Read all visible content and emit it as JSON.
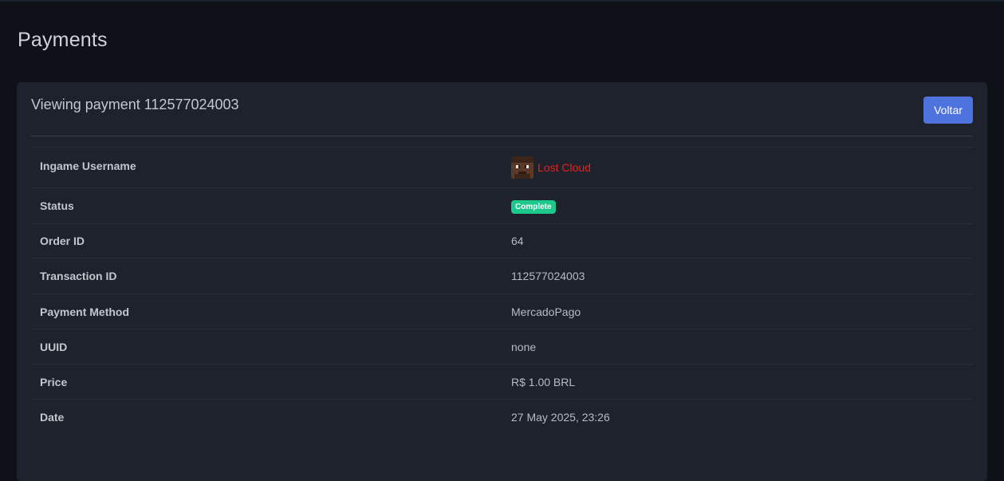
{
  "page": {
    "title": "Payments"
  },
  "card": {
    "title": "Viewing payment 112577024003",
    "back_label": "Voltar"
  },
  "details": {
    "username_label": "Ingame Username",
    "username_value": "Lost Cloud",
    "status_label": "Status",
    "status_value": "Complete",
    "order_label": "Order ID",
    "order_value": "64",
    "transaction_label": "Transaction ID",
    "transaction_value": "112577024003",
    "method_label": "Payment Method",
    "method_value": "MercadoPago",
    "uuid_label": "UUID",
    "uuid_value": "none",
    "price_label": "Price",
    "price_value": "R$ 1.00 BRL",
    "date_label": "Date",
    "date_value": "27 May 2025, 23:26"
  },
  "colors": {
    "accent": "#4e73df",
    "status_complete": "#1cc88a",
    "username": "#e8211d"
  }
}
